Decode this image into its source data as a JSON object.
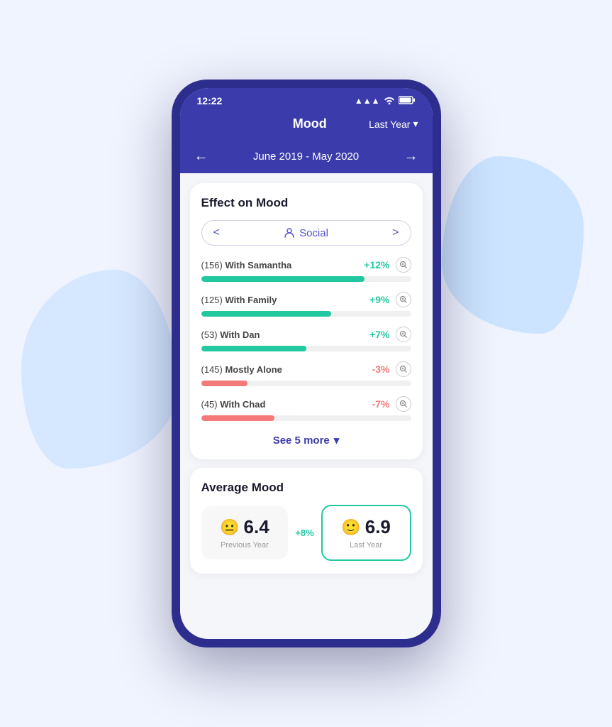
{
  "scene": {
    "statusBar": {
      "time": "12:22",
      "signal": "▲▲▲",
      "wifi": "WiFi",
      "battery": "🔋"
    },
    "header": {
      "title": "Mood",
      "period": "Last Year",
      "periodIcon": "▾"
    },
    "navBar": {
      "leftArrow": "←",
      "rightArrow": "→",
      "dateRange": "June 2019 - May 2020"
    },
    "effectOnMood": {
      "cardTitle": "Effect on Mood",
      "categoryLeftChevron": "<",
      "categoryRightChevron": ">",
      "categoryIcon": "👤",
      "categoryLabel": "Social",
      "items": [
        {
          "count": "156",
          "name": "With Samantha",
          "percent": "+12%",
          "type": "positive",
          "barWidth": 78
        },
        {
          "count": "125",
          "name": "With Family",
          "percent": "+9%",
          "type": "positive",
          "barWidth": 62
        },
        {
          "count": "53",
          "name": "With Dan",
          "percent": "+7%",
          "type": "positive",
          "barWidth": 50
        },
        {
          "count": "145",
          "name": "Mostly Alone",
          "percent": "-3%",
          "type": "negative",
          "barWidth": 22
        },
        {
          "count": "45",
          "name": "With Chad",
          "percent": "-7%",
          "type": "negative",
          "barWidth": 35
        }
      ],
      "seeMore": "See 5 more",
      "seeMoreIcon": "▾"
    },
    "averageMood": {
      "cardTitle": "Average Mood",
      "change": "+8%",
      "previousYear": {
        "emoji": "😐",
        "value": "6.4",
        "label": "Previous Year"
      },
      "lastYear": {
        "emoji": "🙂",
        "value": "6.9",
        "label": "Last Year"
      }
    }
  }
}
